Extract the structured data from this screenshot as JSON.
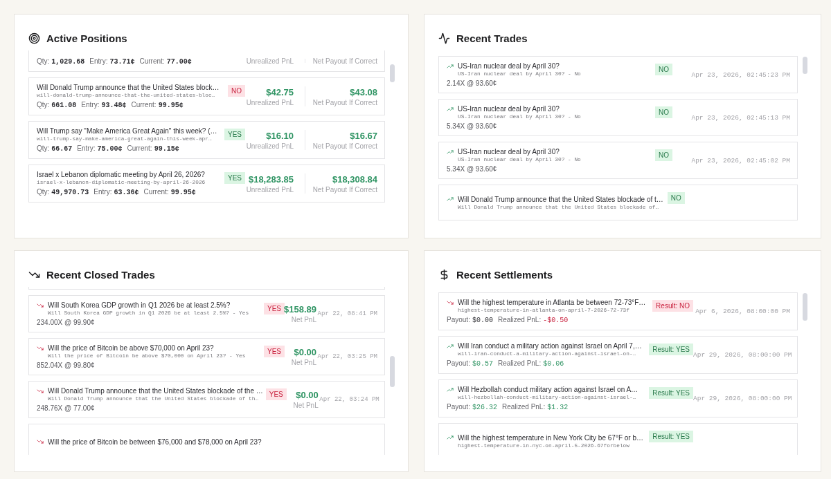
{
  "active_positions": {
    "title": "Active Positions",
    "rows": [
      {
        "kind": "partial",
        "stats": [
          {
            "label": "Qty:",
            "value": "1,029.68"
          },
          {
            "label": "Entry:",
            "value": "73.71¢"
          },
          {
            "label": "Current:",
            "value": "77.00¢"
          }
        ],
        "pnl": {
          "label": "Unrealized PnL"
        },
        "payout": {
          "label": "Net Payout If Correct"
        }
      },
      {
        "kind": "full",
        "title": "Will Donald Trump announce that the United States block…",
        "slug": "will-donald-trump-announce-that-the-united-states-bloc…",
        "side": {
          "text": "NO",
          "positive": false
        },
        "stats": [
          {
            "label": "Qty:",
            "value": "661.08"
          },
          {
            "label": "Entry:",
            "value": "93.48¢"
          },
          {
            "label": "Current:",
            "value": "99.95¢"
          }
        ],
        "pnl": {
          "value": "$42.75",
          "label": "Unrealized PnL"
        },
        "payout": {
          "value": "$43.08",
          "label": "Net Payout If Correct"
        }
      },
      {
        "kind": "full",
        "title": "Will Trump say \"Make America Great Again\" this week? (…",
        "slug": "will-trump-say-make-america-great-again-this-week-apr…",
        "side": {
          "text": "YES",
          "positive": true
        },
        "stats": [
          {
            "label": "Qty:",
            "value": "66.67"
          },
          {
            "label": "Entry:",
            "value": "75.00¢"
          },
          {
            "label": "Current:",
            "value": "99.15¢"
          }
        ],
        "pnl": {
          "value": "$16.10",
          "label": "Unrealized PnL"
        },
        "payout": {
          "value": "$16.67",
          "label": "Net Payout If Correct"
        }
      },
      {
        "kind": "full",
        "title": "Israel x Lebanon diplomatic meeting by April 26, 2026?",
        "slug": "israel-x-lebanon-diplomatic-meeting-by-april-26-2026",
        "side": {
          "text": "YES",
          "positive": true
        },
        "stats": [
          {
            "label": "Qty:",
            "value": "49,970.73"
          },
          {
            "label": "Entry:",
            "value": "63.36¢"
          },
          {
            "label": "Current:",
            "value": "99.95¢"
          }
        ],
        "pnl": {
          "value": "$18,283.85",
          "label": "Unrealized PnL"
        },
        "payout": {
          "value": "$18,308.84",
          "label": "Net Payout If Correct"
        }
      }
    ]
  },
  "recent_trades": {
    "title": "Recent Trades",
    "rows": [
      {
        "rising": true,
        "title": "US-Iran nuclear deal by April 30?",
        "subtitle": "US-Iran nuclear deal by April 30? - No",
        "detail": "2.14X @ 93.60¢",
        "side": {
          "text": "NO",
          "positive": true
        },
        "time": "Apr 23, 2026, 02:45:23 PM"
      },
      {
        "rising": true,
        "title": "US-Iran nuclear deal by April 30?",
        "subtitle": "US-Iran nuclear deal by April 30? - No",
        "detail": "5.34X @ 93.60¢",
        "side": {
          "text": "NO",
          "positive": true
        },
        "time": "Apr 23, 2026, 02:45:13 PM"
      },
      {
        "rising": true,
        "title": "US-Iran nuclear deal by April 30?",
        "subtitle": "US-Iran nuclear deal by April 30? - No",
        "detail": "5.34X @ 93.60¢",
        "side": {
          "text": "NO",
          "positive": true
        },
        "time": "Apr 23, 2026, 02:45:02 PM"
      },
      {
        "rising": true,
        "title": "Will Donald Trump announce that the United States blockade of t…",
        "subtitle": "Will Donald Trump announce that the United States blockade of…",
        "side": {
          "text": "NO",
          "positive": true
        }
      }
    ]
  },
  "recent_closed_trades": {
    "title": "Recent Closed Trades",
    "rows": [
      {
        "rising": false,
        "title": "Will South Korea GDP growth in Q1 2026 be at least 2.5%?",
        "subtitle": "Will South Korea GDP growth in Q1 2026 be at least 2.5%? - Yes",
        "detail": "234.00X @ 99.90¢",
        "side": {
          "text": "YES",
          "positive": false
        },
        "pnl": {
          "value": "$158.89",
          "label": "Net PnL"
        },
        "time": "Apr 22, 08:41 PM"
      },
      {
        "rising": false,
        "title": "Will the price of Bitcoin be above $70,000 on April 23?",
        "subtitle": "Will the price of Bitcoin be above $70,000 on April 23? - Yes",
        "detail": "852.04X @ 99.80¢",
        "side": {
          "text": "YES",
          "positive": false
        },
        "pnl": {
          "value": "$0.00",
          "label": "Net PnL"
        },
        "time": "Apr 22, 03:25 PM"
      },
      {
        "rising": false,
        "title": "Will Donald Trump announce that the United States blockade of the …",
        "subtitle": "Will Donald Trump announce that the United States blockade of th…",
        "detail": "248.76X @ 77.00¢",
        "side": {
          "text": "YES",
          "positive": false
        },
        "pnl": {
          "value": "$0.00",
          "label": "Net PnL"
        },
        "time": "Apr 22, 03:24 PM"
      },
      {
        "rising": false,
        "title": "Will the price of Bitcoin be between $76,000 and $78,000 on April 23?"
      }
    ]
  },
  "recent_settlements": {
    "title": "Recent Settlements",
    "rows": [
      {
        "rising": false,
        "title": "Will the highest temperature in Atlanta be between 72-73°F…",
        "slug": "highest-temperature-in-atlanta-on-april-7-2026-72-73f",
        "payout": {
          "label": "Payout:",
          "value": "$0.00",
          "kind": "flat"
        },
        "pnl": {
          "label": "Realized PnL:",
          "value": "-$0.50",
          "kind": "loss"
        },
        "result": {
          "text": "Result: NO",
          "positive": false
        },
        "time": "Apr 6, 2026, 08:00:00 PM"
      },
      {
        "rising": true,
        "title": "Will Iran conduct a military action against Israel on April 7,…",
        "slug": "will-iran-conduct-a-military-action-against-israel-on-…",
        "payout": {
          "label": "Payout:",
          "value": "$0.57",
          "kind": "gain"
        },
        "pnl": {
          "label": "Realized PnL:",
          "value": "$0.06",
          "kind": "gain"
        },
        "result": {
          "text": "Result: YES",
          "positive": true
        },
        "time": "Apr 29, 2026, 08:00:00 PM"
      },
      {
        "rising": true,
        "title": "Will Hezbollah conduct military action against Israel on A…",
        "slug": "will-hezbollah-conduct-military-action-against-israel-…",
        "payout": {
          "label": "Payout:",
          "value": "$26.32",
          "kind": "gain"
        },
        "pnl": {
          "label": "Realized PnL:",
          "value": "$1.32",
          "kind": "gain"
        },
        "result": {
          "text": "Result: YES",
          "positive": true
        },
        "time": "Apr 29, 2026, 08:00:00 PM"
      },
      {
        "rising": true,
        "title": "Will the highest temperature in New York City be 67°F or b…",
        "slug": "highest-temperature-in-nyc-on-april-5-2026-67forbelow",
        "result": {
          "text": "Result: YES",
          "positive": true
        }
      }
    ]
  }
}
